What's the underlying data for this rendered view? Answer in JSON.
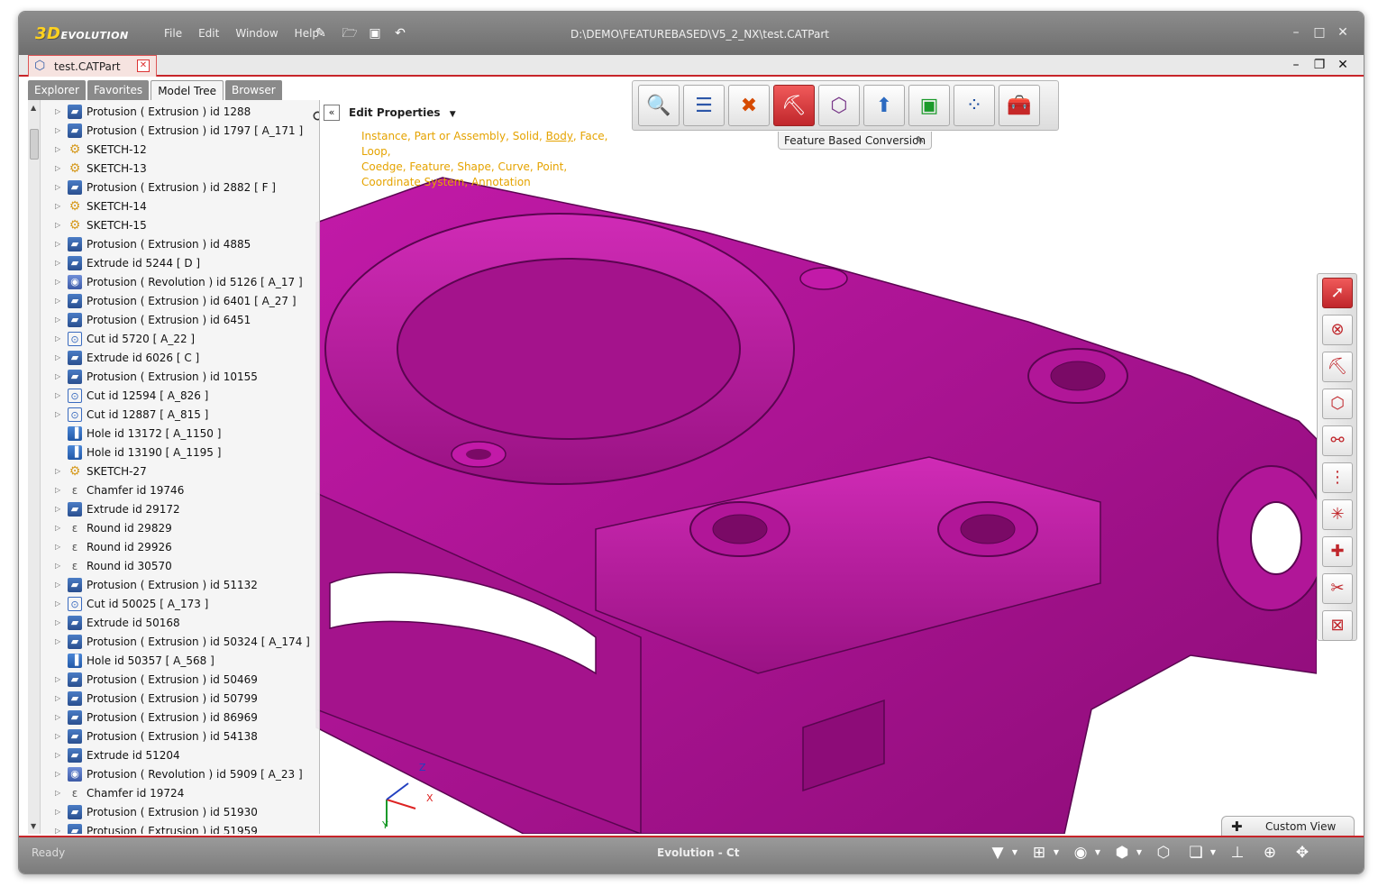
{
  "app": {
    "logo_3d": "3D",
    "logo_text": "EVOLUTION",
    "menu": [
      "File",
      "Edit",
      "Window",
      "Help"
    ],
    "path": "D:\\DEMO\\FEATUREBASED\\V5_2_NX\\test.CATPart"
  },
  "doc_tab": {
    "label": "test.CATPart"
  },
  "panel_tabs": [
    "Explorer",
    "Favorites",
    "Model Tree",
    "Browser"
  ],
  "tree_items": [
    {
      "label": "Protusion ( Extrusion ) id 1288",
      "icon": "ext"
    },
    {
      "label": "Protusion ( Extrusion ) id 1797 [ A_171 ]",
      "icon": "ext"
    },
    {
      "label": "SKETCH-12",
      "icon": "sk"
    },
    {
      "label": "SKETCH-13",
      "icon": "sk"
    },
    {
      "label": "Protusion ( Extrusion ) id 2882 [ F ]",
      "icon": "ext"
    },
    {
      "label": "SKETCH-14",
      "icon": "sk"
    },
    {
      "label": "SKETCH-15",
      "icon": "sk"
    },
    {
      "label": "Protusion ( Extrusion ) id 4885",
      "icon": "ext"
    },
    {
      "label": "Extrude id 5244 [ D ]",
      "icon": "ext"
    },
    {
      "label": "Protusion ( Revolution ) id 5126 [ A_17 ]",
      "icon": "rev"
    },
    {
      "label": "Protusion ( Extrusion ) id 6401 [ A_27 ]",
      "icon": "ext"
    },
    {
      "label": "Protusion ( Extrusion ) id 6451",
      "icon": "ext"
    },
    {
      "label": "Cut id 5720 [ A_22 ]",
      "icon": "cut"
    },
    {
      "label": "Extrude id 6026 [ C ]",
      "icon": "ext"
    },
    {
      "label": "Protusion ( Extrusion ) id 10155",
      "icon": "ext"
    },
    {
      "label": "Cut id 12594 [ A_826 ]",
      "icon": "cut"
    },
    {
      "label": "Cut id 12887 [ A_815 ]",
      "icon": "cut"
    },
    {
      "label": "Hole id 13172 [ A_1150 ]",
      "icon": "hole"
    },
    {
      "label": "Hole id 13190 [ A_1195 ]",
      "icon": "hole"
    },
    {
      "label": "SKETCH-27",
      "icon": "sk"
    },
    {
      "label": "Chamfer id 19746",
      "icon": "ch"
    },
    {
      "label": "Extrude id 29172",
      "icon": "ext"
    },
    {
      "label": "Round id 29829",
      "icon": "ch"
    },
    {
      "label": "Round id 29926",
      "icon": "ch"
    },
    {
      "label": "Round id 30570",
      "icon": "ch"
    },
    {
      "label": "Protusion ( Extrusion ) id 51132",
      "icon": "ext"
    },
    {
      "label": "Cut id 50025 [ A_173 ]",
      "icon": "cut"
    },
    {
      "label": "Extrude id 50168",
      "icon": "ext"
    },
    {
      "label": "Protusion ( Extrusion ) id 50324 [ A_174 ]",
      "icon": "ext"
    },
    {
      "label": "Hole id 50357 [ A_568 ]",
      "icon": "hole"
    },
    {
      "label": "Protusion ( Extrusion ) id 50469",
      "icon": "ext"
    },
    {
      "label": "Protusion ( Extrusion ) id 50799",
      "icon": "ext"
    },
    {
      "label": "Protusion ( Extrusion ) id 86969",
      "icon": "ext"
    },
    {
      "label": "Protusion ( Extrusion ) id 54138",
      "icon": "ext"
    },
    {
      "label": "Extrude id 51204",
      "icon": "ext"
    },
    {
      "label": "Protusion ( Revolution ) id 5909 [ A_23 ]",
      "icon": "rev"
    },
    {
      "label": "Chamfer id 19724",
      "icon": "ch"
    },
    {
      "label": "Protusion ( Extrusion ) id 51930",
      "icon": "ext"
    },
    {
      "label": "Protusion ( Extrusion ) id 51959",
      "icon": "ext"
    }
  ],
  "edit_properties": {
    "title": "Edit Properties",
    "links_line1": "Instance, Part or Assembly, Solid,",
    "link_body": "Body",
    "links_line1b": ", Face, Loop,",
    "links_line2": "Coedge, Feature, Shape, Curve, Point,",
    "links_line3": "Coordinate System, Annotation"
  },
  "toolbar": {
    "label": "Feature Based Conversion",
    "buttons": [
      "search-icon",
      "edit-list-icon",
      "tools-icon",
      "feature-based-icon",
      "cube-move-icon",
      "upload-icon",
      "frame-icon",
      "select-points-icon",
      "toolbox-icon"
    ]
  },
  "axis": {
    "x": "X",
    "y": "Y",
    "z": "Z"
  },
  "custom_view": "Custom View",
  "status": {
    "left": "Ready",
    "center": "Evolution - Ct"
  },
  "colors": {
    "accent": "#c7252a",
    "model": "#b5179b",
    "link": "#e5a300"
  }
}
